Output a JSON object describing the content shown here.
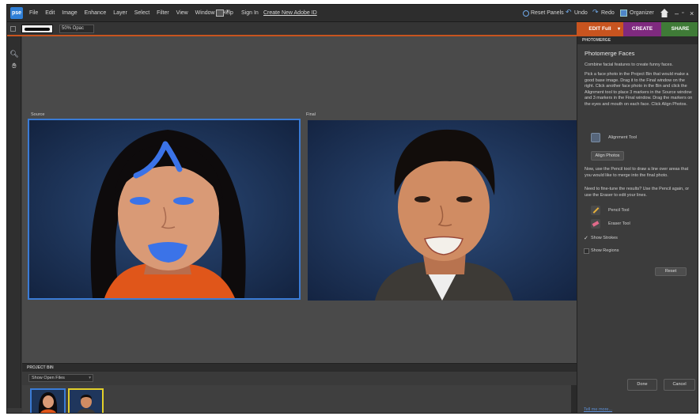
{
  "app": {
    "logo": "pse"
  },
  "menu": [
    "File",
    "Edit",
    "Image",
    "Enhance",
    "Layer",
    "Select",
    "Filter",
    "View",
    "Window",
    "Help"
  ],
  "signin": {
    "sign_in": "Sign In",
    "create": "Create New Adobe ID"
  },
  "right_menu": {
    "reset_panels": "Reset Panels",
    "undo": "Undo",
    "redo": "Redo",
    "organizer": "Organizer"
  },
  "options": {
    "size_value": "50%   Opac"
  },
  "tabs": {
    "edit": "EDIT Full",
    "create": "CREATE",
    "share": "SHARE"
  },
  "colors": {
    "accent": "#c8541f",
    "create_tab": "#8a2a8a",
    "share_tab": "#4b8a3a",
    "selection": "#3a7bd5"
  },
  "canvas": {
    "source_label": "Source",
    "final_label": "Final"
  },
  "bin": {
    "header": "PROJECT BIN",
    "select": "Show Open Files"
  },
  "panel": {
    "header": "PHOTOMERGE",
    "title": "Photomerge Faces",
    "subtitle": "Combine facial features to create funny faces.",
    "instructions": "Pick a face photo in the Project Bin that would make a good base image. Drag it to the Final window on the right. Click another face photo in the Bin and click the Alignment tool to place 3 markers in the Source window and 3 markers in the Final window. Drag the markers on the eyes and mouth on each face. Click Align Photos.",
    "alignment_tool": "Alignment Tool",
    "align_photos": "Align Photos",
    "pencil_instructions": "Now, use the Pencil tool to draw a line over areas that you would like to merge into the final photo.",
    "fine_tune": "Need to fine-tune the results? Use the Pencil again, or use the Eraser to edit your lines.",
    "pencil_tool": "Pencil Tool",
    "eraser_tool": "Eraser Tool",
    "show_strokes": "Show Strokes",
    "show_regions": "Show Regions",
    "reset": "Reset",
    "done": "Done",
    "cancel": "Cancel",
    "tell_me_more": "Tell me more..."
  }
}
